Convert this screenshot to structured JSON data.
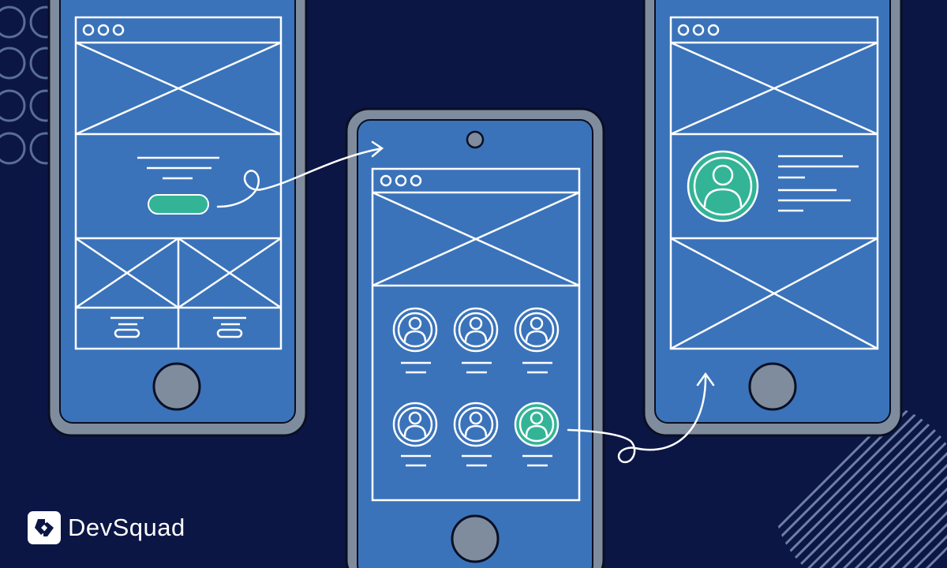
{
  "brand": {
    "name": "DevSquad"
  },
  "colors": {
    "background": "#0b1645",
    "phone_frame": "#7f8c9d",
    "screen": "#3a73ba",
    "wireframe_line": "#ffffff",
    "accent": "#33b496",
    "outline": "#0a0f22"
  },
  "icons": [
    "dot-grid-decoration",
    "diagonal-stripes-decoration",
    "profile-avatar-icon",
    "flow-arrow",
    "logo-mark-icon"
  ]
}
